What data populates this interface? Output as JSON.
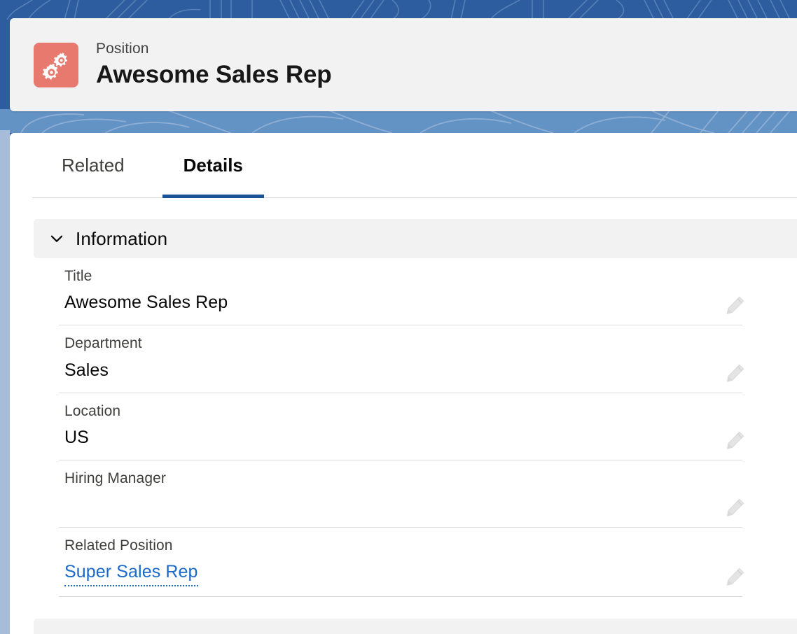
{
  "theme": {
    "backdrop_blue": "#2d5d9e",
    "backdrop_blue_light": "#6392c4",
    "icon_background": "#e8796e",
    "active_tab_underline": "#1b5297",
    "link_blue": "#1b6ac9",
    "section_band": "#f3f2f2"
  },
  "record_header": {
    "icon_name": "cogs-icon",
    "object_label": "Position",
    "record_title": "Awesome Sales Rep"
  },
  "tabs": [
    {
      "label": "Related",
      "active": false,
      "name": "tab-related"
    },
    {
      "label": "Details",
      "active": true,
      "name": "tab-details"
    }
  ],
  "section": {
    "toggle_icon": "chevron-down-icon",
    "title": "Information"
  },
  "fields": [
    {
      "label": "Title",
      "value": "Awesome Sales Rep",
      "is_link": false,
      "edit_icon": "pencil-icon"
    },
    {
      "label": "Department",
      "value": "Sales",
      "is_link": false,
      "edit_icon": "pencil-icon"
    },
    {
      "label": "Location",
      "value": "US",
      "is_link": false,
      "edit_icon": "pencil-icon"
    },
    {
      "label": "Hiring Manager",
      "value": "",
      "is_link": false,
      "edit_icon": "pencil-icon"
    },
    {
      "label": "Related Position",
      "value": "Super Sales Rep",
      "is_link": true,
      "edit_icon": "pencil-icon"
    }
  ]
}
